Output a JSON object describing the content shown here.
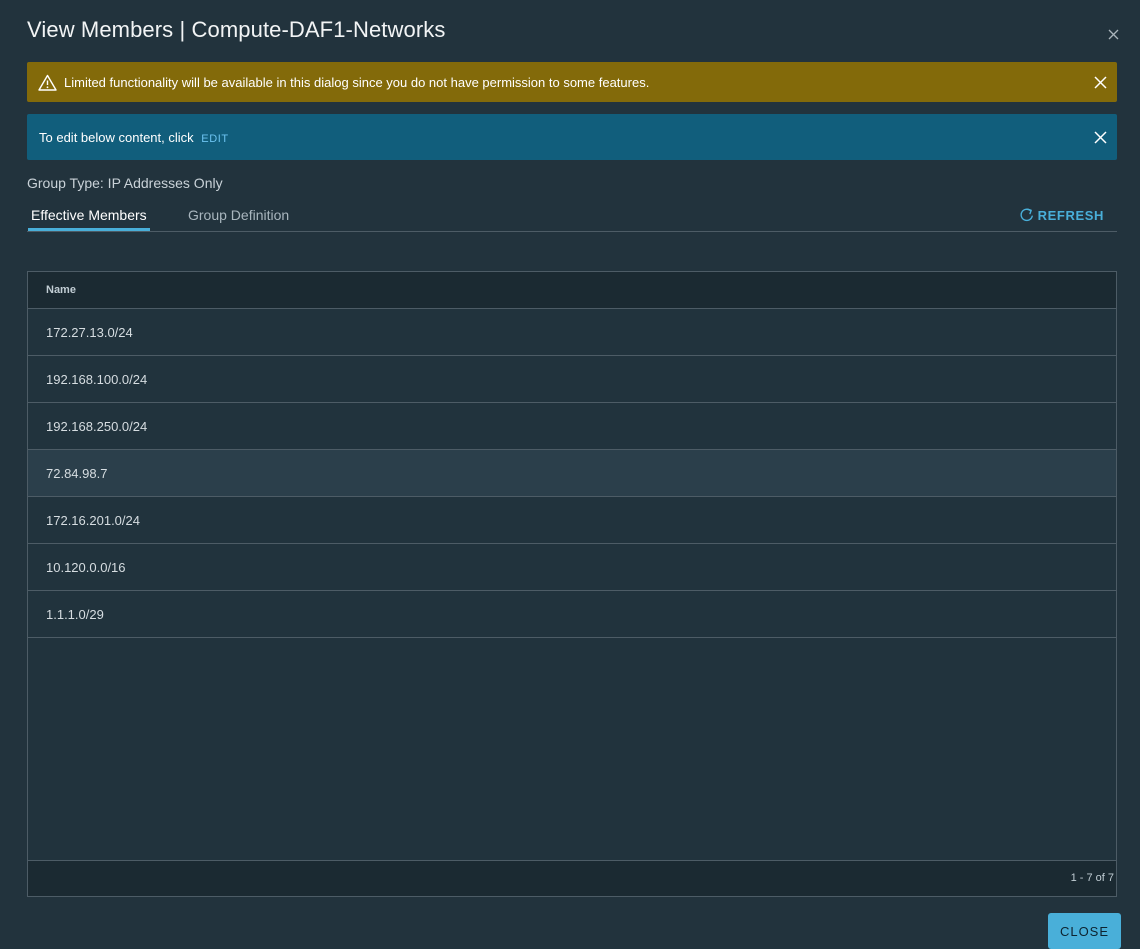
{
  "dialog": {
    "title": "View Members | Compute-DAF1-Networks",
    "close_icon": "close-icon"
  },
  "alerts": {
    "warning": {
      "icon": "warning-triangle-icon",
      "text": "Limited functionality will be available in this dialog since you do not have permission to some features.",
      "color": "#836a0a"
    },
    "info": {
      "text": "To edit below content, click",
      "link": "EDIT",
      "color": "#115e7c"
    }
  },
  "group_type": "Group Type: IP Addresses Only",
  "tabs": [
    {
      "label": "Effective Members",
      "active": true
    },
    {
      "label": "Group Definition",
      "active": false
    }
  ],
  "refresh": {
    "label": "REFRESH",
    "icon": "refresh-icon"
  },
  "grid": {
    "columns": [
      "Name"
    ],
    "rows": [
      {
        "name": "172.27.13.0/24"
      },
      {
        "name": "192.168.100.0/24"
      },
      {
        "name": "192.168.250.0/24"
      },
      {
        "name": "72.84.98.7"
      },
      {
        "name": "172.16.201.0/24"
      },
      {
        "name": "10.120.0.0/16"
      },
      {
        "name": "1.1.1.0/29"
      }
    ],
    "footer": "1 - 7 of 7"
  },
  "buttons": {
    "close": "CLOSE"
  },
  "colors": {
    "accent": "#49afd9",
    "background": "#21333d"
  }
}
